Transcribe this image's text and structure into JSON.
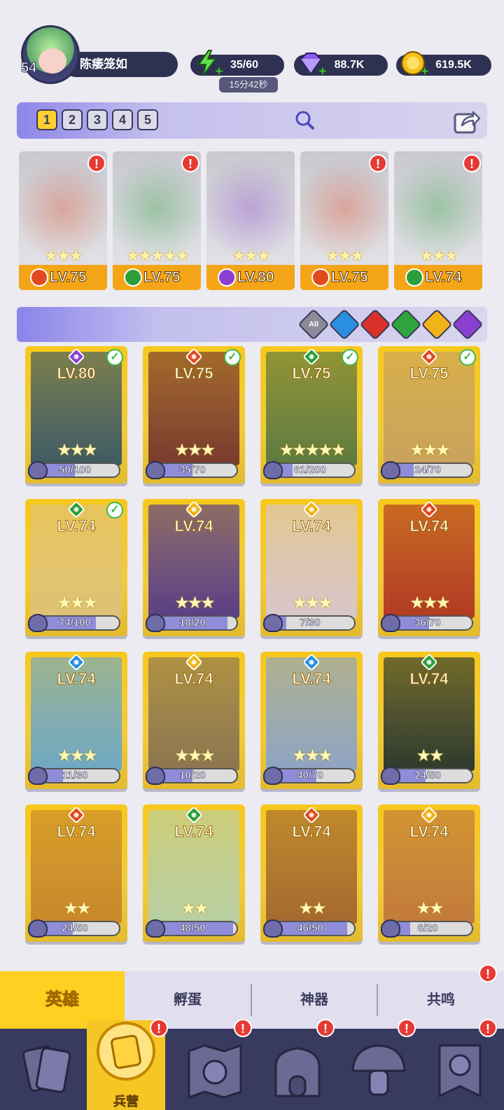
{
  "player": {
    "level": "54",
    "name": "陈痿笼如"
  },
  "resources": {
    "energy": "35/60",
    "energy_timer": "15分42秒",
    "gems": "88.7K",
    "coins": "619.5K"
  },
  "team": {
    "slots": [
      "1",
      "2",
      "3",
      "4",
      "5"
    ],
    "active_slot": "1",
    "heroes": [
      {
        "level": "LV.75",
        "element": "fire",
        "stars": "★★★",
        "alert": "!"
      },
      {
        "level": "LV.75",
        "element": "nature",
        "stars": "★★★★★",
        "alert": "!"
      },
      {
        "level": "LV.80",
        "element": "dark",
        "stars": "★★★",
        "alert": ""
      },
      {
        "level": "LV.75",
        "element": "fire",
        "stars": "★★★",
        "alert": "!"
      },
      {
        "level": "LV.74",
        "element": "nature",
        "stars": "★★★",
        "alert": "!"
      }
    ]
  },
  "filters": [
    {
      "label": "All",
      "color": "#8a8a9a"
    },
    {
      "label": "",
      "color": "#2a8fe0"
    },
    {
      "label": "",
      "color": "#d8322b"
    },
    {
      "label": "",
      "color": "#2fa43c"
    },
    {
      "label": "",
      "color": "#f1b317"
    },
    {
      "label": "",
      "color": "#8a3fd0"
    }
  ],
  "colors": {
    "fire": "#e04a1e",
    "nature": "#2c9f3a",
    "dark": "#8a3fd0",
    "water": "#2a8fe0",
    "light": "#f1b317"
  },
  "heroes": [
    {
      "level": "LV.80",
      "element": "dark",
      "progress": "50/100",
      "ratio": 0.5,
      "stars": "★★★",
      "selected": true,
      "tint": "#3e5b63"
    },
    {
      "level": "LV.75",
      "element": "fire",
      "progress": "35/70",
      "ratio": 0.5,
      "stars": "★★★",
      "selected": true,
      "tint": "#7a3b2e"
    },
    {
      "level": "LV.75",
      "element": "nature",
      "progress": "61/200",
      "ratio": 0.305,
      "stars": "★★★★★",
      "selected": true,
      "tint": "#5f7a3e"
    },
    {
      "level": "LV.75",
      "element": "fire",
      "progress": "24/70",
      "ratio": 0.343,
      "stars": "★★★",
      "selected": true,
      "tint": "#c9a25c"
    },
    {
      "level": "LV.74",
      "element": "nature",
      "progress": "74/100",
      "ratio": 0.74,
      "stars": "★★★",
      "selected": true,
      "tint": "#e0c276"
    },
    {
      "level": "LV.74",
      "element": "light",
      "progress": "18/20",
      "ratio": 0.9,
      "stars": "★★★",
      "selected": false,
      "tint": "#5a3f86"
    },
    {
      "level": "LV.74",
      "element": "light",
      "progress": "7/30",
      "ratio": 0.233,
      "stars": "★★★",
      "selected": false,
      "tint": "#d9c6c9"
    },
    {
      "level": "LV.74",
      "element": "fire",
      "progress": "36/70",
      "ratio": 0.514,
      "stars": "★★★",
      "selected": false,
      "tint": "#b23a22"
    },
    {
      "level": "LV.74",
      "element": "water",
      "progress": "11/30",
      "ratio": 0.367,
      "stars": "★★★",
      "selected": false,
      "tint": "#6fa8c4"
    },
    {
      "level": "LV.74",
      "element": "light",
      "progress": "10/20",
      "ratio": 0.5,
      "stars": "★★★",
      "selected": false,
      "tint": "#8c7550"
    },
    {
      "level": "LV.74",
      "element": "water",
      "progress": "40/70",
      "ratio": 0.571,
      "stars": "★★★",
      "selected": false,
      "tint": "#8ea4c4"
    },
    {
      "level": "LV.74",
      "element": "nature",
      "progress": "24/50",
      "ratio": 0.48,
      "stars": "★★",
      "selected": false,
      "tint": "#2f3a2e"
    },
    {
      "level": "LV.74",
      "element": "fire",
      "progress": "24/50",
      "ratio": 0.48,
      "stars": "★★",
      "selected": false,
      "tint": "#c8882a"
    },
    {
      "level": "LV.74",
      "element": "nature",
      "progress": "48/50",
      "ratio": 0.96,
      "stars": "★★",
      "selected": false,
      "tint": "#b8cfa2"
    },
    {
      "level": "LV.74",
      "element": "fire",
      "progress": "46/50",
      "ratio": 0.92,
      "stars": "★★",
      "selected": false,
      "tint": "#a5692e"
    },
    {
      "level": "LV.74",
      "element": "light",
      "progress": "6/20",
      "ratio": 0.3,
      "stars": "★★",
      "selected": false,
      "tint": "#c27a3a"
    }
  ],
  "subtabs": [
    {
      "label": "英雄",
      "active": true,
      "alert": ""
    },
    {
      "label": "孵蛋",
      "active": false,
      "alert": ""
    },
    {
      "label": "神器",
      "active": false,
      "alert": ""
    },
    {
      "label": "共鸣",
      "active": false,
      "alert": "!"
    }
  ],
  "bottom_nav": [
    {
      "icon": "cards-icon",
      "label": "",
      "active": false,
      "alert": ""
    },
    {
      "icon": "barracks-icon",
      "label": "兵营",
      "active": true,
      "alert": "!"
    },
    {
      "icon": "map-icon",
      "label": "",
      "active": false,
      "alert": "!"
    },
    {
      "icon": "castle-icon",
      "label": "",
      "active": false,
      "alert": "!"
    },
    {
      "icon": "mushroom-icon",
      "label": "",
      "active": false,
      "alert": "!"
    },
    {
      "icon": "banner-icon",
      "label": "",
      "active": false,
      "alert": "!"
    }
  ]
}
